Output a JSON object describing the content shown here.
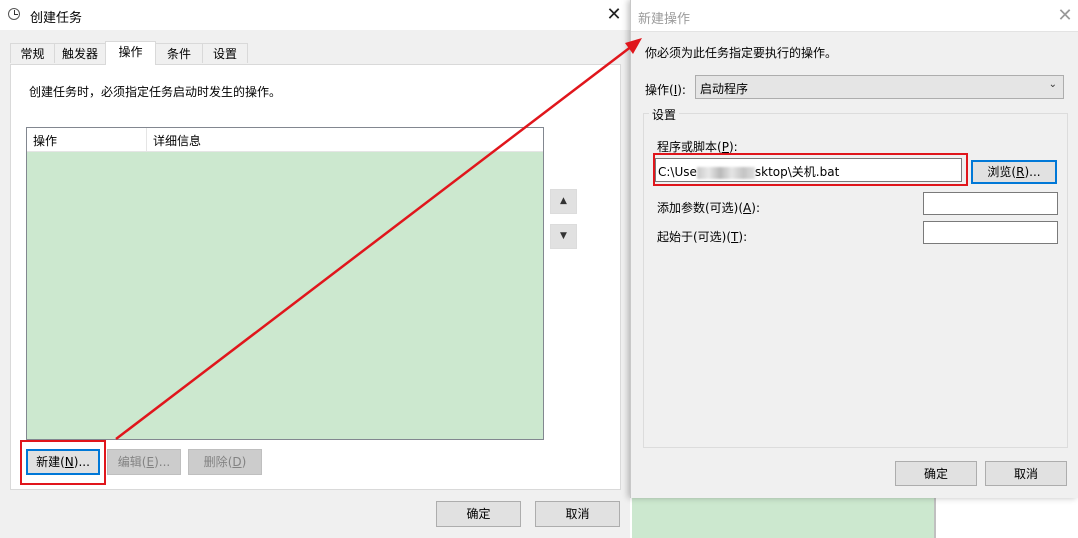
{
  "create_task": {
    "title": "创建任务",
    "tabs": [
      {
        "label": "常规",
        "active": false
      },
      {
        "label": "触发器",
        "active": false
      },
      {
        "label": "操作",
        "active": true
      },
      {
        "label": "条件",
        "active": false
      },
      {
        "label": "设置",
        "active": false
      }
    ],
    "description": "创建任务时，必须指定任务启动时发生的操作。",
    "grid_columns": [
      "操作",
      "详细信息"
    ],
    "buttons": {
      "new": {
        "text": "新建",
        "key": "N",
        "suffix": "..."
      },
      "edit": {
        "text": "编辑",
        "key": "E",
        "suffix": "..."
      },
      "delete": {
        "text": "删除",
        "key": "D",
        "suffix": ""
      }
    },
    "ok": "确定",
    "cancel": "取消"
  },
  "new_action": {
    "title": "新建操作",
    "instruction": "你必须为此任务指定要执行的操作。",
    "action_label": "操作(",
    "action_key": "I",
    "action_label_end": "):",
    "action_value": "启动程序",
    "group_title": "设置",
    "program_label": "程序或脚本(",
    "program_key": "P",
    "program_label_end": "):",
    "program_value_start": "C:\\Use",
    "program_value_end": "sktop\\关机.bat",
    "browse": {
      "text": "浏览(",
      "key": "R",
      "suffix": ")..."
    },
    "args_label": "添加参数(可选)(",
    "args_key": "A",
    "args_label_end": "):",
    "start_label": "起始于(可选)(",
    "start_key": "T",
    "start_label_end": "):",
    "ok": "确定",
    "cancel": "取消"
  },
  "colors": {
    "highlight_red": "#e0161c",
    "grid_green": "#cce8cf",
    "focus_blue": "#0078d7"
  },
  "icons": {
    "app_icon": "clock-icon",
    "close": "close-icon",
    "up": "arrow-up-icon",
    "down": "arrow-down-icon",
    "dropdown": "chevron-down-icon"
  }
}
